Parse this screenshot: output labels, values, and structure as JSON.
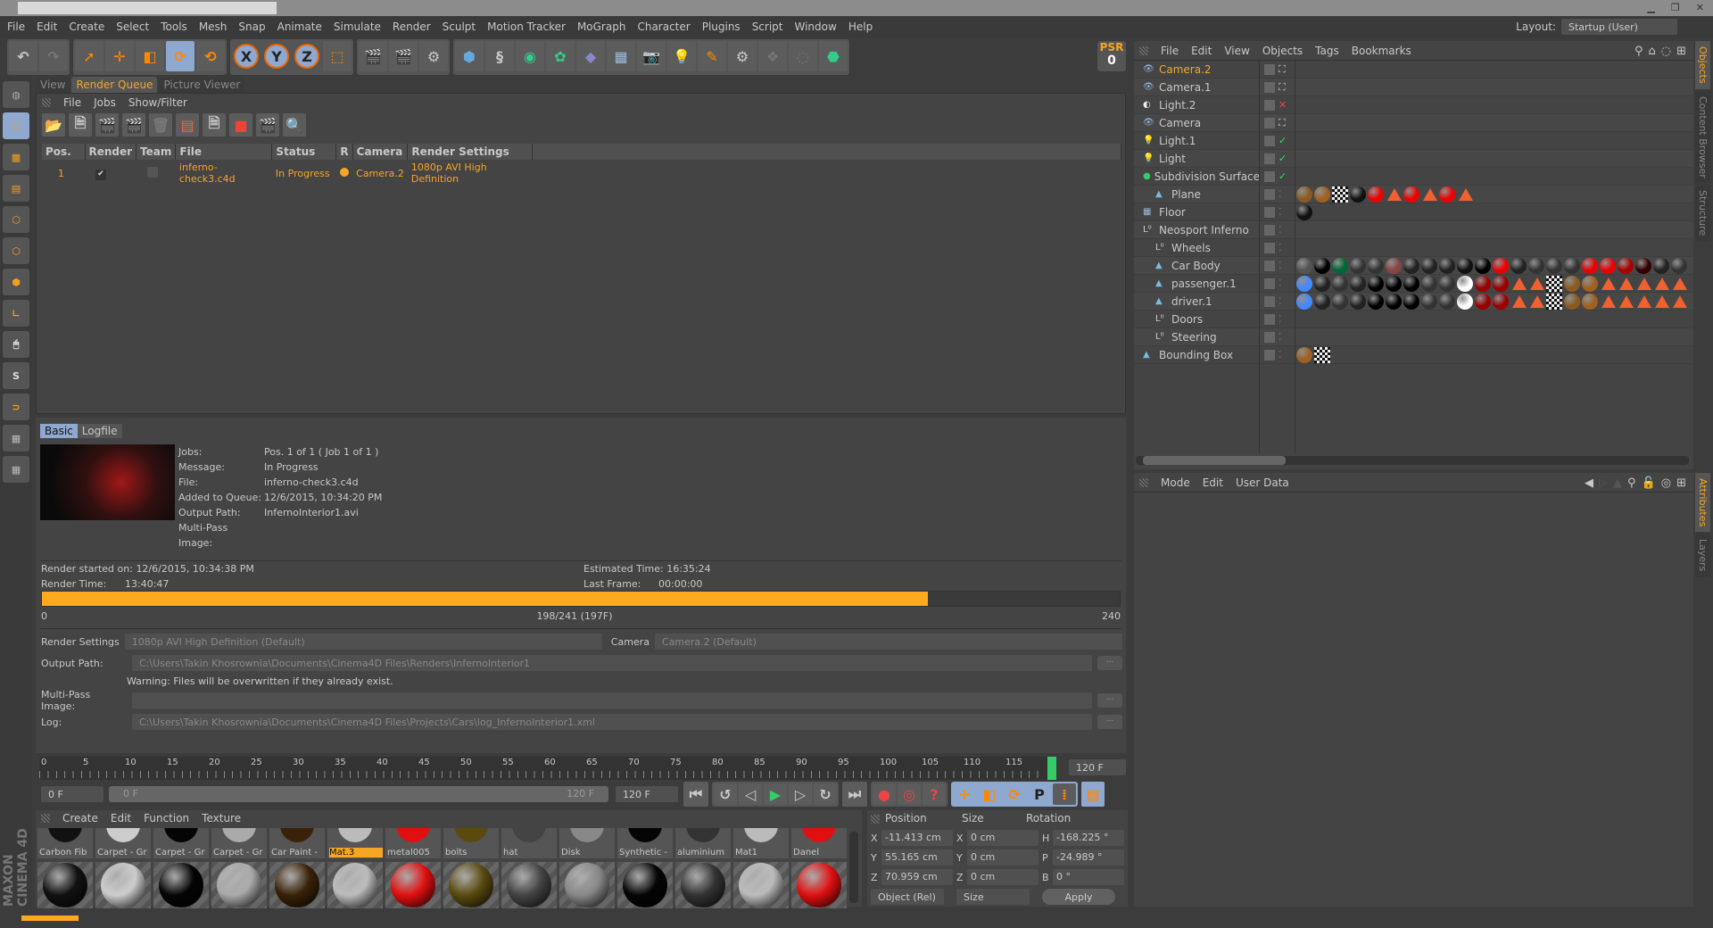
{
  "menu": [
    "File",
    "Edit",
    "Create",
    "Select",
    "Tools",
    "Mesh",
    "Snap",
    "Animate",
    "Simulate",
    "Render",
    "Sculpt",
    "Motion Tracker",
    "MoGraph",
    "Character",
    "Plugins",
    "Script",
    "Window",
    "Help"
  ],
  "layout": {
    "label": "Layout:",
    "value": "Startup (User)"
  },
  "psr": {
    "label": "PSR",
    "value": "0"
  },
  "toolbar_axes": [
    "X",
    "Y",
    "Z"
  ],
  "viewtabs": [
    "View",
    "Render Queue",
    "Picture Viewer"
  ],
  "rq_menu": [
    "File",
    "Jobs",
    "Show/Filter"
  ],
  "rq_table": {
    "headers": [
      "Pos.",
      "Render",
      "Team",
      "File",
      "Status",
      "R",
      "Camera",
      "Render Settings"
    ],
    "rows": [
      {
        "pos": "1",
        "render": "✔",
        "file": "inferno-check3.c4d",
        "status": "In Progress",
        "camera": "Camera.2",
        "settings": "1080p AVI High Definition"
      }
    ]
  },
  "details_tabs": [
    "Basic",
    "Logfile"
  ],
  "details": [
    {
      "k": "Jobs:",
      "v": "Pos. 1 of 1 ( Job 1 of 1 )"
    },
    {
      "k": "Message:",
      "v": "In Progress"
    },
    {
      "k": "File:",
      "v": "inferno-check3.c4d"
    },
    {
      "k": "Added to Queue:",
      "v": "12/6/2015, 10:34:20 PM"
    },
    {
      "k": "Output Path:",
      "v": "InfernoInterior1.avi"
    },
    {
      "k": "Multi-Pass Image:",
      "v": ""
    }
  ],
  "render_started": {
    "label": "Render started on:",
    "value": "12/6/2015, 10:34:38 PM"
  },
  "render_time": {
    "label": "Render Time:",
    "value": "13:40:47"
  },
  "estimated": {
    "label": "Estimated Time:",
    "value": "16:35:24"
  },
  "last_frame": {
    "label": "Last Frame:",
    "value": "00:00:00"
  },
  "progress": {
    "percent": 82.2,
    "start": "0",
    "mid": "198/241 (197F)",
    "end": "240",
    "color": "#ffa91f"
  },
  "settings": {
    "render_settings_label": "Render Settings",
    "render_settings_value": "1080p AVI High Definition (Default)",
    "camera_label": "Camera",
    "camera_value": "Camera.2 (Default)",
    "output_label": "Output Path:",
    "output_value": "C:\\Users\\Takin Khosrownia\\Documents\\Cinema4D Files\\Renders\\InfernoInterior1",
    "warning": "Warning: Files will be overwritten if they already exist.",
    "multipass_label": "Multi-Pass Image:",
    "multipass_value": "",
    "log_label": "Log:",
    "log_value": "C:\\Users\\Takin Khosrownia\\Documents\\Cinema4D Files\\Projects\\Cars\\log_InfernoInterior1.xml",
    "browse": "..."
  },
  "timeline": {
    "ticks": [
      "0",
      "5",
      "10",
      "15",
      "20",
      "25",
      "30",
      "35",
      "40",
      "45",
      "50",
      "55",
      "60",
      "65",
      "70",
      "75",
      "80",
      "85",
      "90",
      "95",
      "100",
      "105",
      "110",
      "115",
      "1"
    ],
    "end_field": "120 F",
    "start_field": "0 F",
    "range_start": "0 F",
    "range_end": "120 F",
    "max_field": "120 F"
  },
  "material_menu": [
    "Create",
    "Edit",
    "Function",
    "Texture"
  ],
  "materials": [
    {
      "name": "Carbon Fib",
      "c": "#111"
    },
    {
      "name": "Carpet - Gr",
      "c": "#ccc"
    },
    {
      "name": "Carpet - Gr",
      "c": "#050505"
    },
    {
      "name": "Carpet - Gr",
      "c": "#aaa"
    },
    {
      "name": "Car Paint -",
      "c": "#3a2208"
    },
    {
      "name": "Mat.3",
      "c": "#bbb"
    },
    {
      "name": "metal005",
      "c": "#e01010"
    },
    {
      "name": "bolts",
      "c": "#5a4a10"
    },
    {
      "name": "hat",
      "c": "#444"
    },
    {
      "name": "Disk",
      "c": "#888"
    },
    {
      "name": "Synthetic -",
      "c": "#050505"
    },
    {
      "name": "aluminium",
      "c": "#333"
    },
    {
      "name": "Mat1",
      "c": "#bbb"
    },
    {
      "name": "Danel",
      "c": "#e01010"
    }
  ],
  "selected_material": "Mat.3",
  "coords": {
    "headers": [
      "Position",
      "Size",
      "Rotation"
    ],
    "rows": [
      {
        "a": "X",
        "p": "-11.413 cm",
        "b": "X",
        "s": "0 cm",
        "c": "H",
        "r": "-168.225 °"
      },
      {
        "a": "Y",
        "p": "55.165 cm",
        "b": "Y",
        "s": "0 cm",
        "c": "P",
        "r": "-24.989 °"
      },
      {
        "a": "Z",
        "p": "70.959 cm",
        "b": "Z",
        "s": "0 cm",
        "c": "B",
        "r": "0 °"
      }
    ],
    "mode": "Object (Rel)",
    "size_mode": "Size",
    "apply": "Apply"
  },
  "obj_menu": [
    "File",
    "Edit",
    "View",
    "Objects",
    "Tags",
    "Bookmarks"
  ],
  "objects": [
    {
      "name": "Camera.2",
      "indent": 0,
      "icon": "camera",
      "active": true,
      "status": "target",
      "tags": []
    },
    {
      "name": "Camera.1",
      "indent": 0,
      "icon": "camera",
      "status": "target",
      "tags": []
    },
    {
      "name": "Light.2",
      "indent": 0,
      "icon": "spotlight",
      "status": "x",
      "tags": []
    },
    {
      "name": "Camera",
      "indent": 0,
      "icon": "camera",
      "status": "target",
      "tags": []
    },
    {
      "name": "Light.1",
      "indent": 0,
      "icon": "light",
      "status": "check",
      "tags": []
    },
    {
      "name": "Light",
      "indent": 0,
      "icon": "light",
      "status": "check",
      "tags": []
    },
    {
      "name": "Subdivision Surface",
      "indent": 0,
      "icon": "subdiv",
      "status": "check",
      "tags": []
    },
    {
      "name": "Plane",
      "indent": 1,
      "icon": "polygon",
      "status": "",
      "tags": [
        "#8a5a20",
        "#a06020",
        "checker",
        "#111",
        "#e00",
        "tri",
        "#e00",
        "tri",
        "#e00",
        "tri"
      ]
    },
    {
      "name": "Floor",
      "indent": 0,
      "icon": "floor",
      "status": "",
      "tags": [
        "#111"
      ]
    },
    {
      "name": "Neosport Inferno",
      "indent": 0,
      "icon": "null",
      "status": "",
      "tags": []
    },
    {
      "name": "Wheels",
      "indent": 1,
      "icon": "null",
      "status": "",
      "tags": []
    },
    {
      "name": "Car Body",
      "indent": 1,
      "icon": "polygon",
      "status": "",
      "tags": [
        "#555",
        "#000",
        "#063",
        "#333",
        "#333",
        "#844",
        "#222",
        "#222",
        "#222",
        "#111",
        "#000",
        "#e00",
        "#222",
        "#333",
        "#333",
        "#333",
        "#e00",
        "#e00",
        "#a00",
        "#300",
        "#222",
        "#333"
      ]
    },
    {
      "name": "passenger.1",
      "indent": 1,
      "icon": "polygon",
      "status": "",
      "tags": [
        "#48f",
        "#222",
        "#333",
        "#222",
        "#000",
        "#000",
        "#000",
        "#333",
        "#333",
        "#fff",
        "#900",
        "#900",
        "tri",
        "tri",
        "checker",
        "#8a5a20",
        "#a06020",
        "tri",
        "tri",
        "tri",
        "tri",
        "tri"
      ]
    },
    {
      "name": "driver.1",
      "indent": 1,
      "icon": "polygon",
      "status": "",
      "tags": [
        "#48f",
        "#222",
        "#333",
        "#222",
        "#000",
        "#000",
        "#000",
        "#333",
        "#333",
        "#fff",
        "#900",
        "#900",
        "tri",
        "tri",
        "checker",
        "#8a5a20",
        "#a06020",
        "tri",
        "tri",
        "tri",
        "tri",
        "tri"
      ]
    },
    {
      "name": "Doors",
      "indent": 1,
      "icon": "null",
      "status": "",
      "tags": []
    },
    {
      "name": "Steering",
      "indent": 1,
      "icon": "null",
      "status": "",
      "tags": []
    },
    {
      "name": "Bounding Box",
      "indent": 0,
      "icon": "polygon",
      "status": "red",
      "tags": [
        "#a06020",
        "checker"
      ]
    }
  ],
  "attr_menu": [
    "Mode",
    "Edit",
    "User Data"
  ],
  "side_tabs_top": [
    "Objects",
    "Content Browser",
    "Structure"
  ],
  "side_tabs_bottom": [
    "Attributes",
    "Layers"
  ],
  "brand": "MAXON CINEMA 4D",
  "colors": {
    "accent": "#f5a623",
    "bg": "#444444"
  }
}
